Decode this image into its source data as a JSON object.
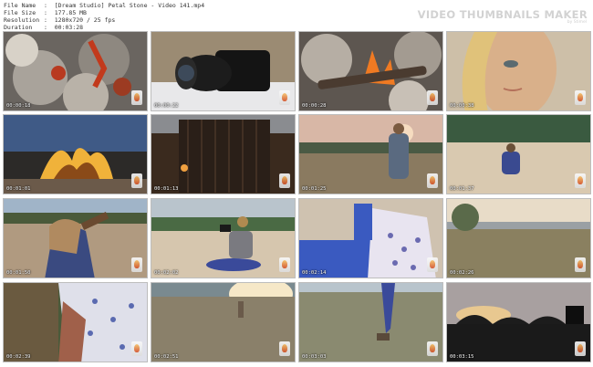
{
  "header": {
    "file_name_label": "File Name",
    "file_name": "[Dream Studio] Petal Stone - Video 141.mp4",
    "file_size_label": "File Size",
    "file_size": "177.85 MB",
    "resolution_label": "Resolution",
    "resolution": "1280x720 / 25 fps",
    "duration_label": "Duration",
    "duration": "00:03:28",
    "brand": "VIDEO THUMBNAILS MAKER",
    "brand_sub": "by Stimel"
  },
  "thumbnails": [
    {
      "time": "00:00:18",
      "scene": "embers"
    },
    {
      "time": "00:00:22",
      "scene": "camera"
    },
    {
      "time": "00:00:28",
      "scene": "fire"
    },
    {
      "time": "00:00:38",
      "scene": "face"
    },
    {
      "time": "00:01:01",
      "scene": "flame"
    },
    {
      "time": "00:01:13",
      "scene": "reeds"
    },
    {
      "time": "00:01:25",
      "scene": "standing"
    },
    {
      "time": "00:01:37",
      "scene": "sitting"
    },
    {
      "time": "00:01:50",
      "scene": "back"
    },
    {
      "time": "00:02:02",
      "scene": "photographer"
    },
    {
      "time": "00:02:14",
      "scene": "closeup"
    },
    {
      "time": "00:02:26",
      "scene": "sea"
    },
    {
      "time": "00:02:39",
      "scene": "blouse"
    },
    {
      "time": "00:02:51",
      "scene": "meadow"
    },
    {
      "time": "00:03:03",
      "scene": "walk"
    },
    {
      "time": "00:03:15",
      "scene": "sunset"
    }
  ]
}
